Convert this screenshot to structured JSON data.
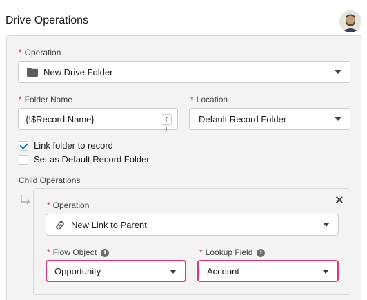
{
  "header": {
    "title": "Drive Operations",
    "avatar_icon": "user-avatar"
  },
  "operation": {
    "label": "Operation",
    "value": "New Drive Folder",
    "icon": "folder-icon"
  },
  "folder_name": {
    "label": "Folder Name",
    "value": "{!$Record.Name}",
    "merge_button": "{ }"
  },
  "location": {
    "label": "Location",
    "value": "Default Record Folder"
  },
  "checkboxes": [
    {
      "label": "Link folder to record",
      "checked": true
    },
    {
      "label": "Set as Default Record Folder",
      "checked": false
    }
  ],
  "child_operations": {
    "label": "Child Operations",
    "operation": {
      "label": "Operation",
      "value": "New Link to Parent",
      "icon": "link-icon"
    },
    "flow_object": {
      "label": "Flow Object",
      "value": "Opportunity"
    },
    "lookup_field": {
      "label": "Lookup Field",
      "value": "Account"
    }
  },
  "colors": {
    "required": "#c23934",
    "highlight": "#e8326d",
    "check": "#0176d3"
  }
}
